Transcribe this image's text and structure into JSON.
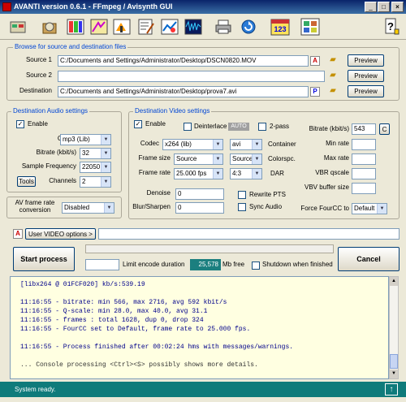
{
  "window": {
    "title": "AVANTI  version  0.6.1  -  FFmpeg / Avisynth GUI",
    "controls": {
      "minimize": "_",
      "maximize": "□",
      "close": "×"
    }
  },
  "toolbar": {
    "icons": [
      "options-icon",
      "package-icon",
      "palette-icon",
      "film-icon",
      "editor-icon",
      "chart-icon",
      "waveform-icon",
      "printer-icon",
      "refresh-icon",
      "calendar-icon",
      "tools-icon",
      "help-icon"
    ]
  },
  "browse": {
    "group_label": "Browse for source and destination files",
    "source1_label": "Source 1",
    "source1_value": "C:/Documents and Settings/Administrator/Desktop/DSCN0820.MOV",
    "source2_label": "Source 2",
    "source2_value": "",
    "destination_label": "Destination",
    "destination_value": "C:/Documents and Settings/Administrator/Desktop/prova7.avi",
    "preview_label": "Preview",
    "a_icon": "A",
    "p_icon": "P"
  },
  "audio": {
    "group_label": "Destination Audio settings",
    "enable_label": "Enable",
    "enable_checked": "✓",
    "codec_label": "Codec",
    "codec_value": "mp3 (Lib)",
    "bitrate_label": "Bitrate (kbit/s)",
    "bitrate_value": "32",
    "samplefreq_label": "Sample Frequency",
    "samplefreq_value": "22050",
    "tools_label": "Tools",
    "channels_label": "Channels",
    "channels_value": "2"
  },
  "avframe": {
    "label1": "AV frame rate",
    "label2": "conversion",
    "value": "Disabled"
  },
  "video": {
    "group_label": "Destination Video settings",
    "enable_label": "Enable",
    "enable_checked": "✓",
    "deinterlace_label": "Deinterlace",
    "auto_badge": "AUTO",
    "twopass_label": "2-pass",
    "codec_label": "Codec",
    "codec_value": "x264 (lib)",
    "container_value": "avi",
    "container_label": "Container",
    "framesize_label": "Frame size",
    "framesize_value": "Source",
    "colorspace_value": "Source",
    "colorspace_label": "Colorspc.",
    "framerate_label": "Frame rate",
    "framerate_value": "25.000 fps",
    "dar_value": "4:3",
    "dar_label": "DAR",
    "denoise_label": "Denoise",
    "denoise_value": "0",
    "blursharpen_label": "Blur/Sharpen",
    "blursharpen_value": "0",
    "rewritepts_label": "Rewrite PTS",
    "syncaudio_label": "Sync Audio",
    "bitrate_label": "Bitrate (kbit/s)",
    "bitrate_value": "543",
    "bitrate_btn": "C",
    "minrate_label": "Min rate",
    "maxrate_label": "Max rate",
    "vbrqscale_label": "VBR qscale",
    "vbvbuffer_label": "VBV buffer size",
    "fourcc_label": "Force FourCC to",
    "fourcc_value": "Default"
  },
  "options": {
    "a_icon": "A",
    "user_video_label": "User VIDEO options >",
    "user_video_value": ""
  },
  "process": {
    "start_label": "Start process",
    "cancel_label": "Cancel",
    "limit_label": "Limit encode duration",
    "mb_free_value": "25,578",
    "mb_free_label": "Mb free",
    "shutdown_label": "Shutdown when finished"
  },
  "console": {
    "lines": [
      "[libx264 @ 01FCF020] kb/s:539.19",
      "",
      "11:16:55 - bitrate: min 566, max 2716, avg 592 kbit/s",
      "11:16:55 - Q-scale: min 28.0, max 40.0, avg 31.1",
      "11:16:55 - frames : total 1628, dup 0, drop 324",
      "11:16:55 - FourCC set to Default, frame rate to 25.000 fps.",
      "",
      "11:16:55 - Process finished after 00:02:24 hms with messages/warnings.",
      "",
      "... Console processing <Ctrl><S> possibly shows more details."
    ]
  },
  "status": {
    "text": "System ready.",
    "arrow": "↑"
  }
}
